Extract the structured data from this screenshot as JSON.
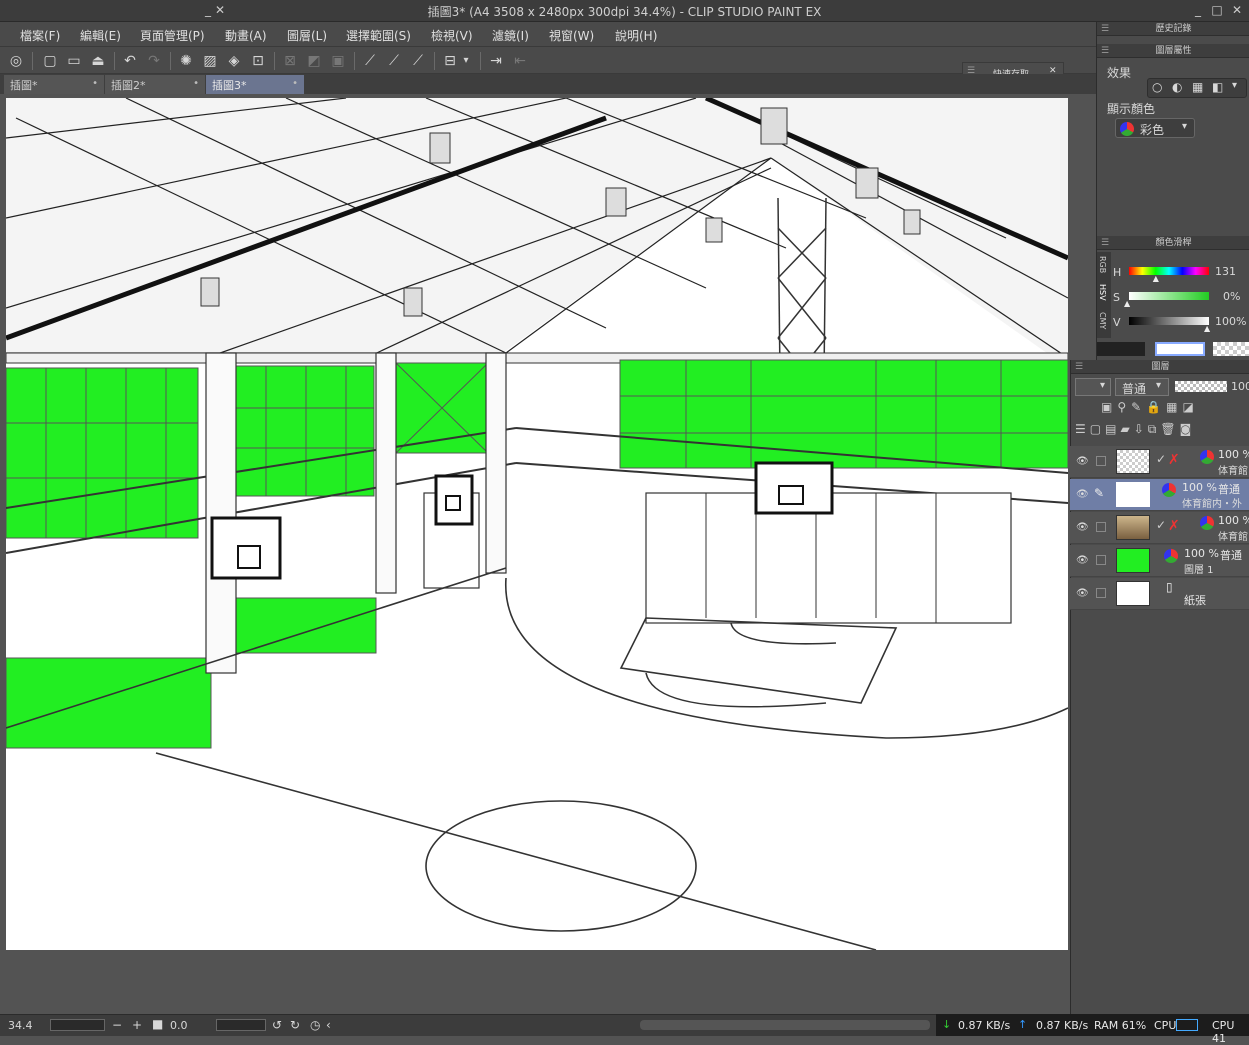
{
  "window": {
    "title": "插圖3* (A4 3508 x 2480px 300dpi 34.4%) - CLIP STUDIO PAINT EX",
    "min_glyph": "_",
    "max_glyph": "□",
    "close_glyph": "✕"
  },
  "menu": [
    "檔案(F)",
    "編輯(E)",
    "頁面管理(P)",
    "動畫(A)",
    "圖層(L)",
    "選擇範圍(S)",
    "檢視(V)",
    "濾鏡(I)",
    "視窗(W)",
    "說明(H)"
  ],
  "tabs": [
    {
      "label": "插圖*",
      "active": false
    },
    {
      "label": "插圖2*",
      "active": false
    },
    {
      "label": "插圖3*",
      "active": true
    }
  ],
  "tab_close_glyph": "•",
  "quick_save": {
    "label": "快速存取",
    "min": "_",
    "close": "✕"
  },
  "panels": {
    "history": "歷史記錄",
    "layer_property": "圖層屬性",
    "effect_label": "效果",
    "display_color_label": "顯示顏色",
    "display_color_value": "彩色",
    "color_slider": "顏色滑桿",
    "layer": "圖層"
  },
  "color_slider": {
    "tabs": [
      "RGB",
      "HSV",
      "CMY"
    ],
    "h_label": "H",
    "h_value": "131",
    "s_label": "S",
    "s_value": "0%",
    "v_label": "V",
    "v_value": "100%",
    "h_fraction": 0.36,
    "s_fraction": 0.0,
    "v_fraction": 1.0
  },
  "layer_panel": {
    "blend_mode": "普通",
    "opacity": "100",
    "layers": [
      {
        "pct": "100 %",
        "mode": "",
        "name": "体育館",
        "selected": false,
        "thumb": "checker"
      },
      {
        "pct": "100 %",
        "mode": "普通",
        "name": "体育館内・外",
        "selected": true,
        "thumb": "white"
      },
      {
        "pct": "100 %",
        "mode": "",
        "name": "体育館",
        "selected": false,
        "thumb": "photo"
      },
      {
        "pct": "100 %",
        "mode": "普通",
        "name": "圖層 1",
        "selected": false,
        "thumb": "green"
      },
      {
        "pct": "",
        "mode": "",
        "name": "紙張",
        "selected": false,
        "thumb": "white"
      }
    ]
  },
  "status": {
    "zoom": "34.4",
    "rotation": "0.0"
  },
  "net": {
    "down": "0.87 KB/s",
    "up": "0.87 KB/s",
    "ram": "RAM 61%",
    "cpu1": "CPU",
    "cpu2": "CPU 41"
  },
  "colors": {
    "accent_tab": "#6b7590",
    "selected_layer": "#6f7ea6",
    "window_green": "#22ee22"
  }
}
